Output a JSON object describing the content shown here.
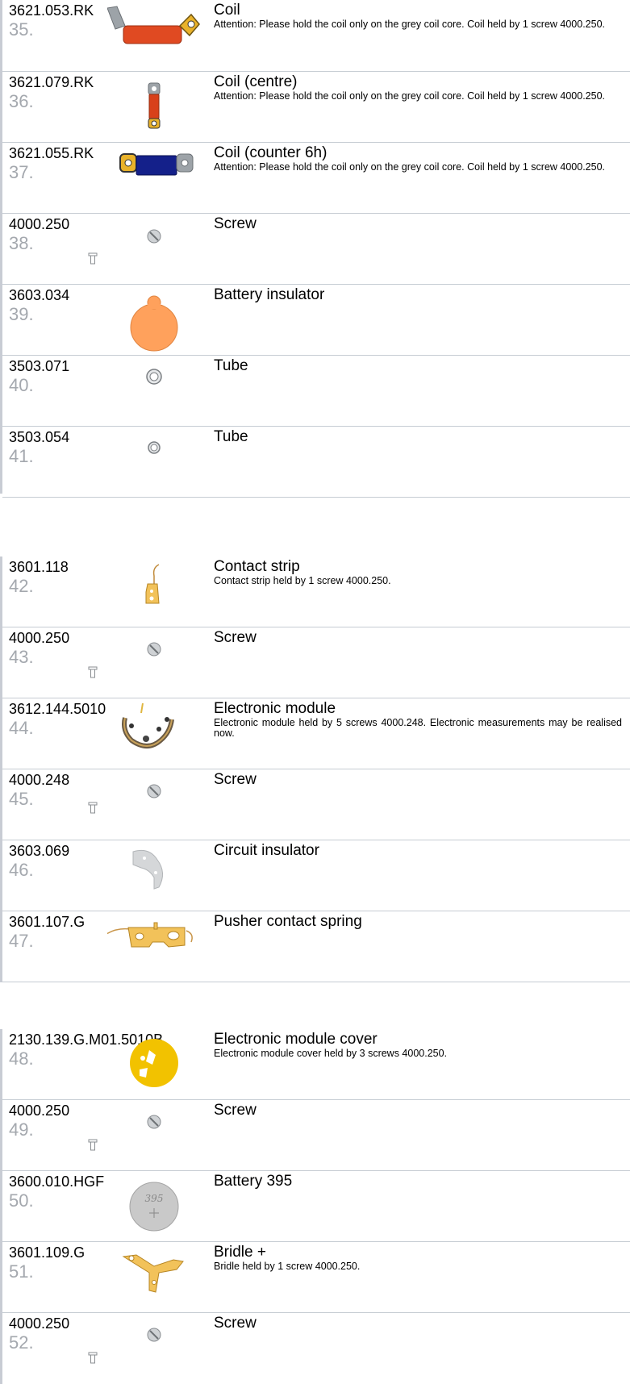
{
  "groups": [
    {
      "rows": [
        {
          "ref": "3621.053.RK",
          "num": "35.",
          "title": "Coil",
          "desc": "Attention: Please hold the coil only on the grey coil core. Coil held by 1 screw 4000.250.",
          "icon": "coil-icon"
        },
        {
          "ref": "3621.079.RK",
          "num": "36.",
          "title": "Coil (centre)",
          "desc": "Attention: Please hold the coil only on the grey coil core. Coil held by 1 screw 4000.250.",
          "icon": "coil-centre-icon"
        },
        {
          "ref": "3621.055.RK",
          "num": "37.",
          "title": "Coil (counter 6h)",
          "desc": "Attention: Please hold the coil only on the grey coil core. Coil held by 1 screw 4000.250.",
          "icon": "coil-counter-icon"
        },
        {
          "ref": "4000.250",
          "num": "38.",
          "title": "Screw",
          "desc": "",
          "icon": "screw-icon"
        },
        {
          "ref": "3603.034",
          "num": "39.",
          "title": "Battery insulator",
          "desc": "",
          "icon": "battery-insulator-icon"
        },
        {
          "ref": "3503.071",
          "num": "40.",
          "title": "Tube",
          "desc": "",
          "icon": "tube-icon"
        },
        {
          "ref": "3503.054",
          "num": "41.",
          "title": "Tube",
          "desc": "",
          "icon": "tube-small-icon"
        }
      ]
    },
    {
      "rows": [
        {
          "ref": "3601.118",
          "num": "42.",
          "title": "Contact strip",
          "desc": "Contact strip held by 1 screw 4000.250.",
          "icon": "contact-strip-icon"
        },
        {
          "ref": "4000.250",
          "num": "43.",
          "title": "Screw",
          "desc": "",
          "icon": "screw-icon"
        },
        {
          "ref": "3612.144.5010",
          "num": "44.",
          "title": "Electronic module",
          "desc": "Electronic module held by 5 screws 4000.248. Electronic measurements may be realised now.",
          "icon": "electronic-module-icon"
        },
        {
          "ref": "4000.248",
          "num": "45.",
          "title": "Screw",
          "desc": "",
          "icon": "screw-icon"
        },
        {
          "ref": "3603.069",
          "num": "46.",
          "title": "Circuit insulator",
          "desc": "",
          "icon": "circuit-insulator-icon"
        },
        {
          "ref": "3601.107.G",
          "num": "47.",
          "title": "Pusher contact spring",
          "desc": "",
          "icon": "pusher-contact-spring-icon"
        }
      ]
    },
    {
      "rows": [
        {
          "ref": "2130.139.G.M01.5010B",
          "num": "48.",
          "title": "Electronic module cover",
          "desc": "Electronic module cover held by 3 screws 4000.250.",
          "icon": "module-cover-icon"
        },
        {
          "ref": "4000.250",
          "num": "49.",
          "title": "Screw",
          "desc": "",
          "icon": "screw-icon"
        },
        {
          "ref": "3600.010.HGF",
          "num": "50.",
          "title": "Battery 395",
          "desc": "",
          "icon": "battery-icon",
          "battery_label": "395"
        },
        {
          "ref": "3601.109.G",
          "num": "51.",
          "title": "Bridle +",
          "desc": "Bridle held by 1 screw 4000.250.",
          "icon": "bridle-icon"
        },
        {
          "ref": "4000.250",
          "num": "52.",
          "title": "Screw",
          "desc": "",
          "icon": "screw-icon"
        }
      ]
    }
  ]
}
